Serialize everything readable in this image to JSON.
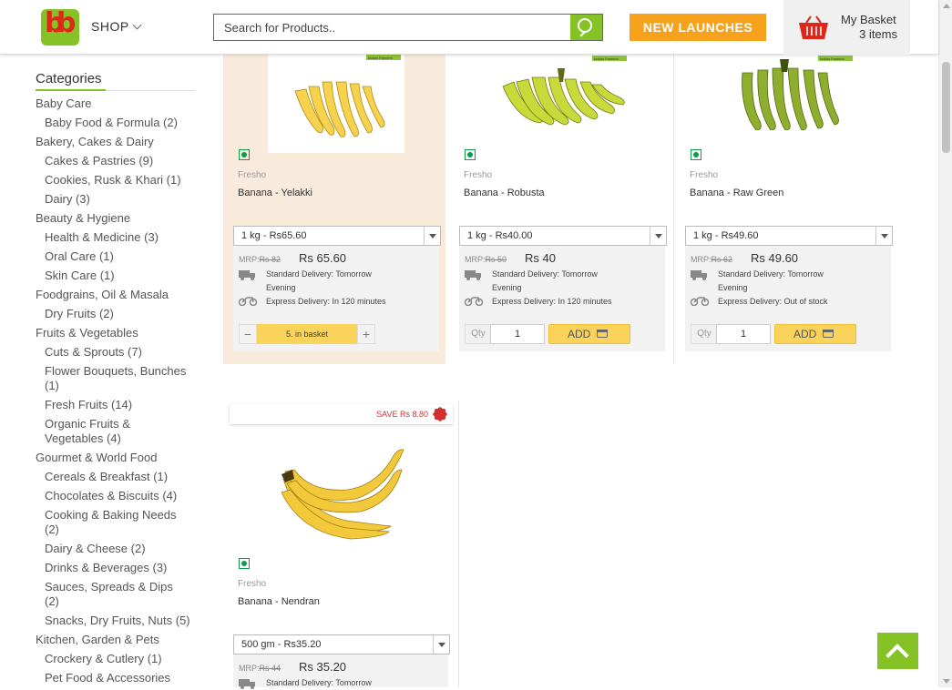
{
  "header": {
    "logo_letters": [
      "b",
      "b"
    ],
    "shop_label": "SHOP",
    "search_placeholder": "Search for Products..",
    "new_launches_label": "NEW LAUNCHES",
    "basket_title": "My Basket",
    "basket_count": "3 items",
    "icons": [
      "chevron-down-icon",
      "search-icon",
      "basket-icon"
    ],
    "colors": {
      "brand_green": "#84c225",
      "brand_red": "#e0261b",
      "new_launch_orange": "#f7a21c"
    }
  },
  "sidebar": {
    "title": "Categories",
    "items": [
      {
        "label": "Baby Care",
        "level": 0
      },
      {
        "label": "Baby Food & Formula (2)",
        "level": 1
      },
      {
        "label": "Bakery, Cakes & Dairy",
        "level": 0
      },
      {
        "label": "Cakes & Pastries (9)",
        "level": 1
      },
      {
        "label": "Cookies, Rusk & Khari (1)",
        "level": 1
      },
      {
        "label": "Dairy (3)",
        "level": 1
      },
      {
        "label": "Beauty & Hygiene",
        "level": 0
      },
      {
        "label": "Health & Medicine (3)",
        "level": 1
      },
      {
        "label": "Oral Care (1)",
        "level": 1
      },
      {
        "label": "Skin Care (1)",
        "level": 1
      },
      {
        "label": "Foodgrains, Oil & Masala",
        "level": 0
      },
      {
        "label": "Dry Fruits (2)",
        "level": 1
      },
      {
        "label": "Fruits & Vegetables",
        "level": 0
      },
      {
        "label": "Cuts & Sprouts (7)",
        "level": 1
      },
      {
        "label": "Flower Bouquets, Bunches (1)",
        "level": 1
      },
      {
        "label": "Fresh Fruits (14)",
        "level": 1
      },
      {
        "label": "Organic Fruits & Vegetables (4)",
        "level": 1
      },
      {
        "label": "Gourmet & World Food",
        "level": 0
      },
      {
        "label": "Cereals & Breakfast (1)",
        "level": 1
      },
      {
        "label": "Chocolates & Biscuits (4)",
        "level": 1
      },
      {
        "label": "Cooking & Baking Needs (2)",
        "level": 1
      },
      {
        "label": "Dairy & Cheese (2)",
        "level": 1
      },
      {
        "label": "Drinks & Beverages (3)",
        "level": 1
      },
      {
        "label": "Sauces, Spreads & Dips (2)",
        "level": 1
      },
      {
        "label": "Snacks, Dry Fruits, Nuts (5)",
        "level": 1
      },
      {
        "label": "Kitchen, Garden & Pets",
        "level": 0
      },
      {
        "label": "Crockery & Cutlery (1)",
        "level": 1
      },
      {
        "label": "Pet Food & Accessories",
        "level": 1
      }
    ]
  },
  "products": [
    {
      "brand": "Fresho",
      "name": "Banana - Yelakki",
      "img_label": "Indian Farmers",
      "pack": "1 kg - Rs65.60",
      "mrp_label": "MRP:",
      "mrp": "Rs 82",
      "price": "Rs 65.60",
      "standard_delivery": "Standard Delivery: Tomorrow Evening",
      "express_delivery": "Express Delivery: In 120 minutes",
      "in_basket": "5. in basket",
      "minus": "−",
      "plus": "+"
    },
    {
      "brand": "Fresho",
      "name": "Banana - Robusta",
      "img_label": "Indian Farmers",
      "pack": "1 kg - Rs40.00",
      "mrp_label": "MRP:",
      "mrp": "Rs 50",
      "price": "Rs 40",
      "standard_delivery": "Standard Delivery: Tomorrow Evening",
      "express_delivery": "Express Delivery: In 120 minutes",
      "qty_label": "Qty",
      "qty": "1",
      "add_label": "ADD"
    },
    {
      "brand": "Fresho",
      "name": "Banana - Raw Green",
      "img_label": "Indian Farmers",
      "pack": "1 kg - Rs49.60",
      "mrp_label": "MRP:",
      "mrp": "Rs 62",
      "price": "Rs 49.60",
      "standard_delivery": "Standard Delivery: Tomorrow Evening",
      "express_delivery": "Express Delivery: Out of stock",
      "qty_label": "Qty",
      "qty": "1",
      "add_label": "ADD"
    },
    {
      "brand": "Fresho",
      "name": "Banana - Nendran",
      "save_tag": "SAVE Rs 8.80",
      "pack": "500 gm - Rs35.20",
      "mrp_label": "MRP:",
      "mrp": "Rs 44",
      "price": "Rs 35.20",
      "standard_delivery": "Standard Delivery: Tomorrow"
    }
  ]
}
